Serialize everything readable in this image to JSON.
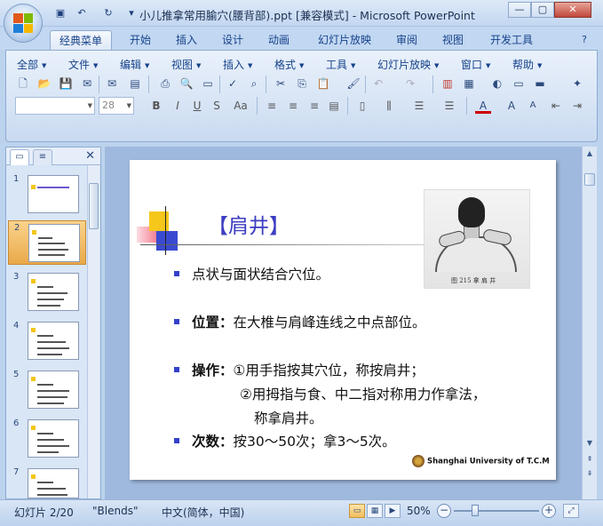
{
  "window": {
    "title": "小儿推拿常用腧穴(腰背部).ppt [兼容模式] - Microsoft PowerPoint",
    "minimize": "—",
    "maximize": "▢",
    "close": "✕"
  },
  "quick_access": [
    "save-icon",
    "undo-icon",
    "redo-icon",
    "customize-icon"
  ],
  "ribbon_tabs": [
    "经典菜单",
    "开始",
    "插入",
    "设计",
    "动画",
    "幻灯片放映",
    "审阅",
    "视图",
    "开发工具"
  ],
  "menu": [
    "全部",
    "文件",
    "编辑",
    "视图",
    "插入",
    "格式",
    "工具",
    "幻灯片放映",
    "窗口",
    "帮助"
  ],
  "format_bar": {
    "font_name": "",
    "font_size": "28",
    "buttons": [
      "B",
      "I",
      "U",
      "S",
      "Aa"
    ]
  },
  "slide_pane": {
    "thumbnails": [
      "1",
      "2",
      "3",
      "4",
      "5",
      "6",
      "7"
    ],
    "selected": "2"
  },
  "slide": {
    "title": "【肩井】",
    "photo_caption": "图 215   拿 肩 井",
    "bullets": [
      {
        "label": "",
        "text": "点状与面状结合穴位。"
      },
      {
        "label": "位置：",
        "text": "在大椎与肩峰连线之中点部位。"
      },
      {
        "label": "操作：",
        "text": "①用手指按其穴位，称按肩井；"
      },
      {
        "label": "次数：",
        "text": "按30～50次；拿3～5次。"
      }
    ],
    "continuation_1": "②用拇指与食、中二指对称用力作拿法，",
    "continuation_2": "称拿肩井。",
    "footer": "Shanghai University of T.C.M"
  },
  "status": {
    "slide_info": "幻灯片 2/20",
    "theme": "\"Blends\"",
    "language": "中文(简体，中国)",
    "zoom": "50%"
  }
}
